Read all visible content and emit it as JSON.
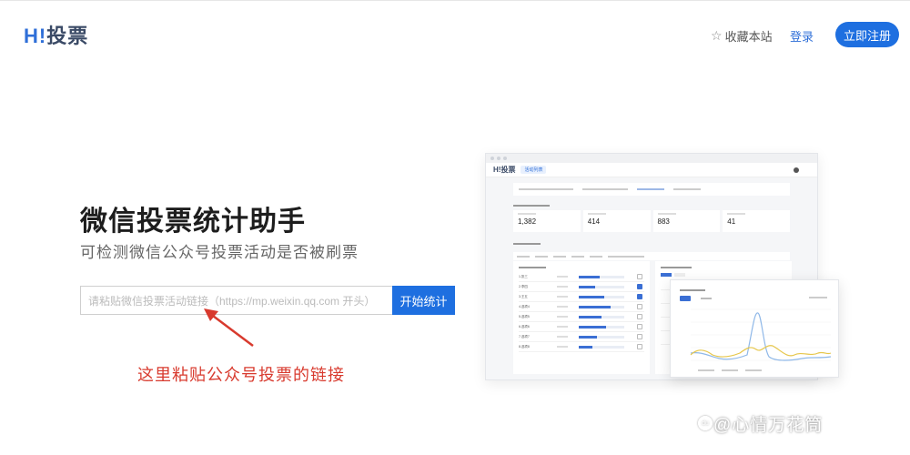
{
  "header": {
    "logo_h": "H",
    "logo_bang": "!",
    "logo_text": "投票",
    "favorite_label": "收藏本站",
    "login_label": "登录",
    "register_label": "立即注册"
  },
  "hero": {
    "title": "微信投票统计助手",
    "subtitle": "可检测微信公众号投票活动是否被刷票",
    "input_placeholder": "请粘贴微信投票活动链接（https://mp.weixin.qq.com 开头）",
    "start_button": "开始统计",
    "hint": "这里粘贴公众号投票的链接"
  },
  "preview": {
    "logo": "H!投票",
    "chip": "活动列表",
    "stats": [
      {
        "value": "1,382"
      },
      {
        "value": "414"
      },
      {
        "value": "883"
      },
      {
        "value": "41"
      }
    ],
    "table_rows": [
      {
        "name": "1.张三",
        "progress": 0.45,
        "checked": false
      },
      {
        "name": "2.李四",
        "progress": 0.35,
        "checked": true
      },
      {
        "name": "3.王五",
        "progress": 0.55,
        "checked": true
      },
      {
        "name": "4.选项4",
        "progress": 0.7,
        "checked": false
      },
      {
        "name": "5.选项5",
        "progress": 0.5,
        "checked": false
      },
      {
        "name": "6.选项6",
        "progress": 0.6,
        "checked": false
      },
      {
        "name": "7.选项7",
        "progress": 0.4,
        "checked": false
      },
      {
        "name": "8.选项8",
        "progress": 0.3,
        "checked": false
      }
    ],
    "colors": {
      "accent": "#3b6fd4",
      "line2": "#e6c64a",
      "line3": "#8fb8e8"
    }
  },
  "watermark": {
    "badge": "du",
    "text": "@心情万花筒"
  }
}
